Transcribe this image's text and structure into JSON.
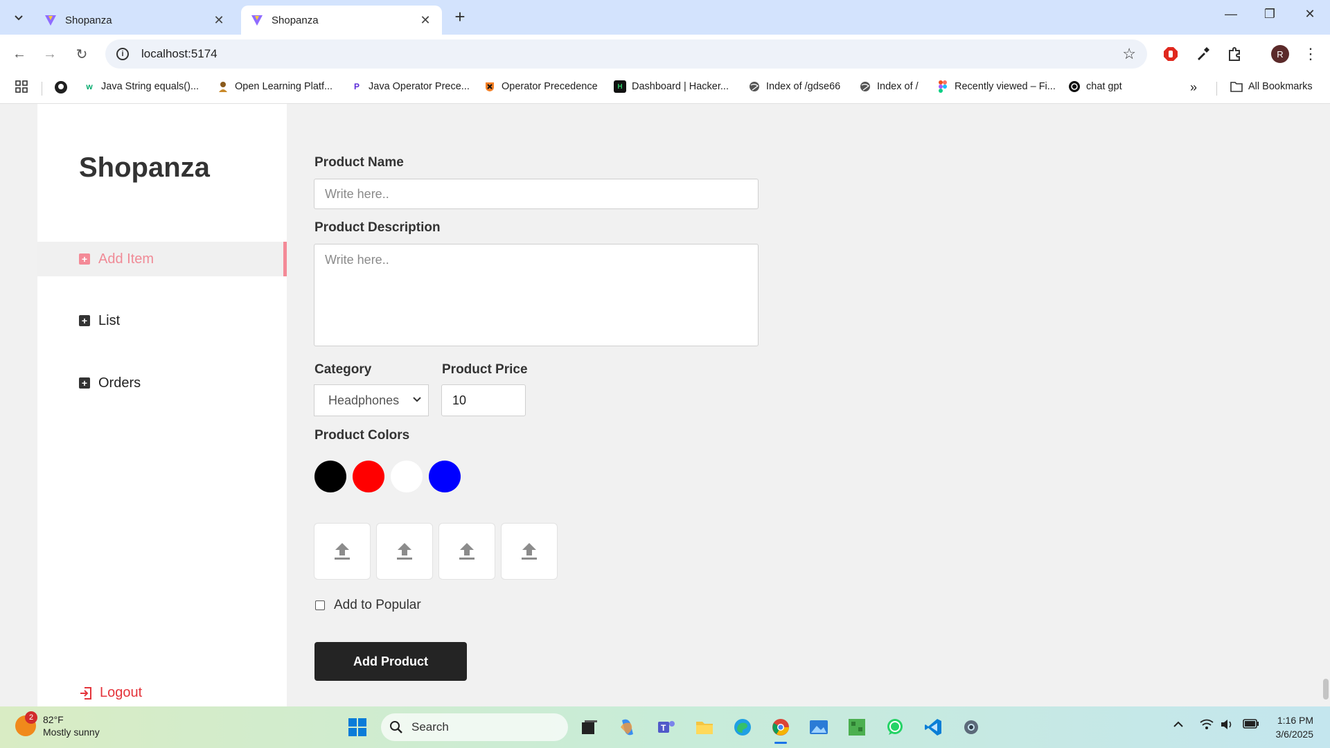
{
  "browser": {
    "tabs": [
      {
        "title": "Shopanza",
        "active": false
      },
      {
        "title": "Shopanza",
        "active": true
      }
    ],
    "url": "localhost:5174",
    "profile_initial": "R",
    "bookmarks": [
      {
        "label": "Java String equals()...",
        "icon": "w3schools-icon"
      },
      {
        "label": "Open Learning Platf...",
        "icon": "open-learning-icon"
      },
      {
        "label": "Java Operator Prece...",
        "icon": "java-icon"
      },
      {
        "label": "Operator Precedence",
        "icon": "princeton-icon"
      },
      {
        "label": "Dashboard | Hacker...",
        "icon": "hackerrank-icon"
      },
      {
        "label": "Index of /gdse66",
        "icon": "globe-icon"
      },
      {
        "label": "Index of /",
        "icon": "globe-icon"
      },
      {
        "label": "Recently viewed – Fi...",
        "icon": "figma-icon"
      },
      {
        "label": "chat gpt",
        "icon": "chatgpt-icon"
      }
    ],
    "all_bookmarks_label": "All Bookmarks"
  },
  "sidebar": {
    "brand": "Shopanza",
    "items": [
      {
        "label": "Add Item",
        "active": true
      },
      {
        "label": "List",
        "active": false
      },
      {
        "label": "Orders",
        "active": false
      }
    ],
    "logout_label": "Logout"
  },
  "form": {
    "product_name_label": "Product Name",
    "product_name_placeholder": "Write here..",
    "product_description_label": "Product Description",
    "product_description_placeholder": "Write here..",
    "category_label": "Category",
    "category_value": "Headphones",
    "price_label": "Product Price",
    "price_value": "10",
    "colors_label": "Product Colors",
    "colors": [
      "#000000",
      "#ff0000",
      "#ffffff",
      "#0000ff"
    ],
    "upload_slots": 4,
    "popular_label": "Add to Popular",
    "submit_label": "Add Product"
  },
  "taskbar": {
    "weather_badge": "2",
    "temperature": "82°F",
    "condition": "Mostly sunny",
    "search_label": "Search",
    "time": "1:16 PM",
    "date": "3/6/2025"
  }
}
